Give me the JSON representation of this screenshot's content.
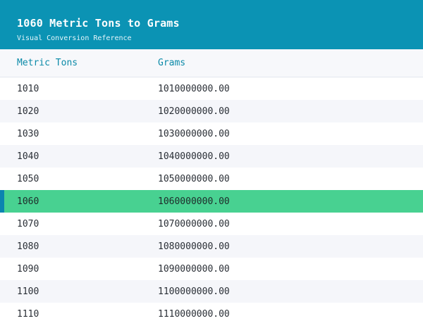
{
  "header": {
    "title": "1060 Metric Tons to Grams",
    "subtitle": "Visual Conversion Reference"
  },
  "columns": {
    "metric_tons": "Metric Tons",
    "grams": "Grams"
  },
  "rows": [
    {
      "tons": "1010",
      "grams": "1010000000.00"
    },
    {
      "tons": "1020",
      "grams": "1020000000.00"
    },
    {
      "tons": "1030",
      "grams": "1030000000.00"
    },
    {
      "tons": "1040",
      "grams": "1040000000.00"
    },
    {
      "tons": "1050",
      "grams": "1050000000.00"
    },
    {
      "tons": "1060",
      "grams": "1060000000.00"
    },
    {
      "tons": "1070",
      "grams": "1070000000.00"
    },
    {
      "tons": "1080",
      "grams": "1080000000.00"
    },
    {
      "tons": "1090",
      "grams": "1090000000.00"
    },
    {
      "tons": "1100",
      "grams": "1100000000.00"
    },
    {
      "tons": "1110",
      "grams": "1110000000.00"
    }
  ],
  "highlighted_index": 5,
  "colors": {
    "header_bg": "#0b93b4",
    "highlight_bg": "#48d191",
    "highlight_marker": "#0b84b0",
    "column_header_text": "#0b8aa8"
  }
}
